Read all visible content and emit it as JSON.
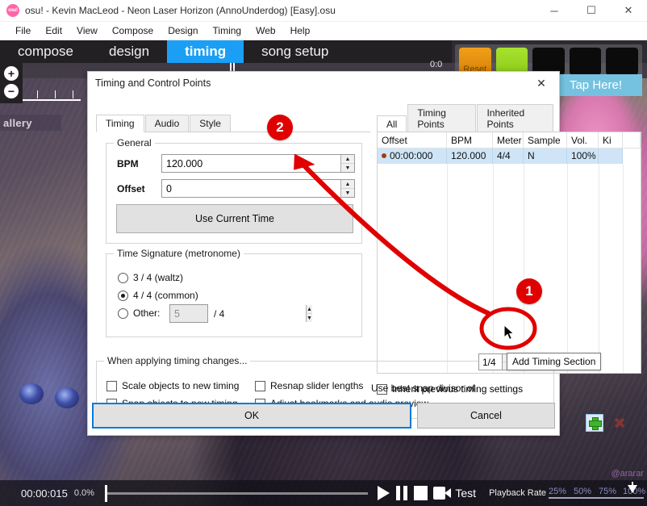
{
  "window": {
    "title": "osu!  - Kevin MacLeod - Neon Laser Horizon (AnnoUnderdog) [Easy].osu",
    "logo_text": "osu!",
    "minimize": "─",
    "maximize": "☐",
    "close": "✕"
  },
  "menubar": {
    "items": [
      "File",
      "Edit",
      "View",
      "Compose",
      "Design",
      "Timing",
      "Web",
      "Help"
    ]
  },
  "editor_toolbar": {
    "tabs": [
      {
        "label": "compose",
        "active": false
      },
      {
        "label": "design",
        "active": false
      },
      {
        "label": "timing",
        "active": true
      },
      {
        "label": "song setup",
        "active": false
      }
    ],
    "timeline_time": "0:0",
    "zoom_in": "+",
    "zoom_out": "−",
    "reset_label": "Reset",
    "tap_here_label": "Tap Here!"
  },
  "dialog": {
    "title": "Timing and Control Points",
    "close_label": "✕",
    "left_tabs": [
      {
        "label": "Timing",
        "active": true
      },
      {
        "label": "Audio",
        "active": false
      },
      {
        "label": "Style",
        "active": false
      }
    ],
    "general": {
      "group_title": "General",
      "bpm_label": "BPM",
      "bpm_value": "120.000",
      "offset_label": "Offset",
      "offset_value": "0",
      "use_current_time": "Use Current Time",
      "spin_up": "▲",
      "spin_down": "▼"
    },
    "time_signature": {
      "group_title": "Time Signature (metronome)",
      "options": [
        {
          "label": "3 / 4 (waltz)",
          "selected": false
        },
        {
          "label": "4 / 4 (common)",
          "selected": true
        },
        {
          "label": "Other:",
          "selected": false
        }
      ],
      "other_value": "5",
      "other_suffix": "/ 4"
    },
    "points_panel": {
      "tabs": [
        {
          "label": "All",
          "active": true
        },
        {
          "label": "Timing Points",
          "active": false
        },
        {
          "label": "Inherited Points",
          "active": false
        }
      ],
      "columns": [
        "Offset",
        "BPM",
        "Meter",
        "Sample",
        "Vol.",
        "Ki"
      ],
      "rows": [
        {
          "offset": "00:00:000",
          "bpm": "120.000",
          "meter": "4/4",
          "sample": "N",
          "vol": "100%",
          "ki": ""
        }
      ],
      "inherit_checkbox": "Inherit previous timing settings",
      "inherit_checked": false,
      "add_icon": "plus-icon",
      "delete_icon": "cross-icon"
    },
    "apply_group": {
      "group_title": "When applying timing changes...",
      "checkboxes": [
        {
          "label": "Scale objects to new timing",
          "checked": false
        },
        {
          "label": "Snap objects to new timing",
          "checked": false
        },
        {
          "label": "Resnap slider lengths",
          "checked": false
        },
        {
          "label": "Adjust bookmarks and audio preview",
          "checked": false
        }
      ],
      "divisor_label": "Use beat snap divisor of",
      "divisor_value": "1/4"
    },
    "ok_label": "OK",
    "cancel_label": "Cancel"
  },
  "tooltip": {
    "text": "Add Timing Section"
  },
  "annotations": {
    "badge_1": "1",
    "badge_2": "2",
    "highlight_color": "#e00000"
  },
  "bottom_bar": {
    "time": "00:00:015",
    "percent": "0.0%",
    "test_label": "Test",
    "playback_rate_label": "Playback Rate",
    "rate_ticks": [
      "25%",
      "50%",
      "75%",
      "100%"
    ],
    "play_icon": "play-icon",
    "pause_icon": "pause-icon",
    "stop_icon": "stop-icon",
    "camera_icon": "camera-icon"
  },
  "background": {
    "gallery_text": "allery",
    "watermark": "@ararar"
  }
}
